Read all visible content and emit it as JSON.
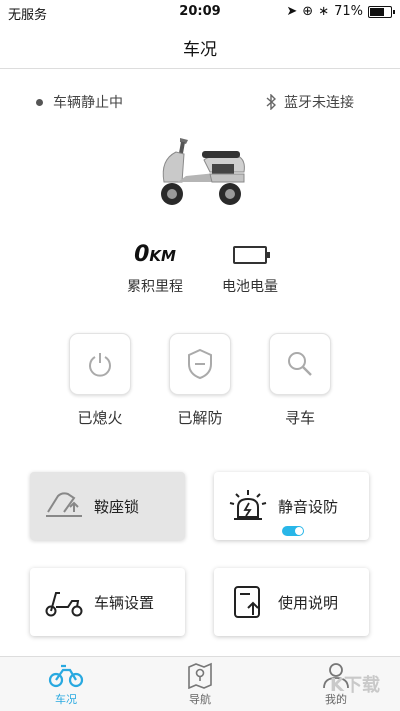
{
  "status_bar": {
    "carrier": "无服务",
    "time": "20:09",
    "battery_text": "71%"
  },
  "nav": {
    "title": "车况"
  },
  "vehicle_status": {
    "motion": "车辆静止中",
    "bluetooth": "蓝牙未连接"
  },
  "stats": {
    "mileage_value": "0",
    "mileage_unit": "KM",
    "mileage_label": "累积里程",
    "battery_label": "电池电量"
  },
  "actions": [
    {
      "label": "已熄火",
      "icon": "power-icon"
    },
    {
      "label": "已解防",
      "icon": "shield-icon"
    },
    {
      "label": "寻车",
      "icon": "search-icon"
    }
  ],
  "cards": {
    "seat_lock": "鞍座锁",
    "silent_arm": "静音设防",
    "vehicle_settings": "车辆设置",
    "manual": "使用说明"
  },
  "tabs": [
    {
      "label": "车况",
      "active": true
    },
    {
      "label": "导航",
      "active": false
    },
    {
      "label": "我的",
      "active": false
    }
  ],
  "watermark": "K下载",
  "colors": {
    "accent": "#29a9e0",
    "toggle_on": "#29b6e8",
    "icon_gray": "#999999"
  }
}
